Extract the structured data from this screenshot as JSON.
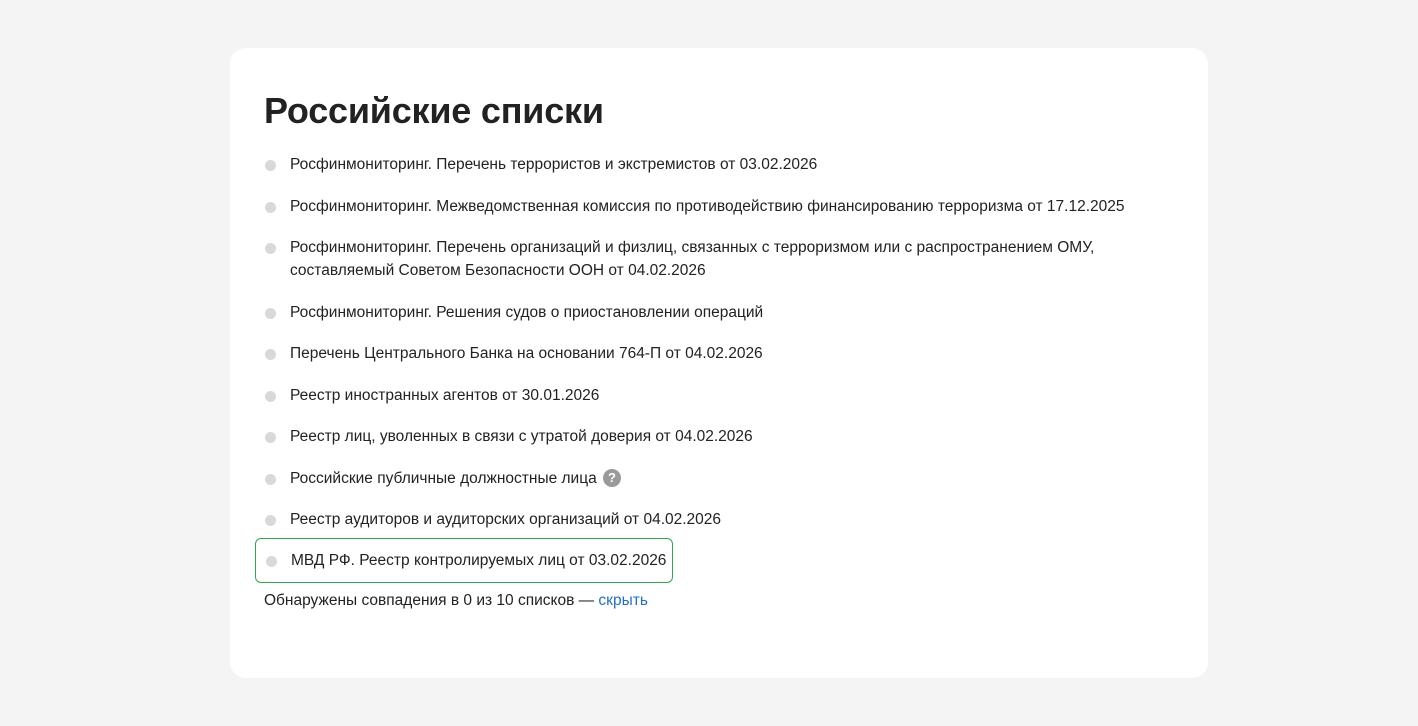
{
  "section": {
    "title": "Российские списки"
  },
  "lists": [
    {
      "label": "Росфинмониторинг. Перечень террористов и экстремистов от 03.02.2026"
    },
    {
      "label": "Росфинмониторинг. Межведомственная комиссия по противодействию финансированию терроризма от 17.12.2025"
    },
    {
      "label": "Росфинмониторинг. Перечень организаций и физлиц, связанных с терроризмом или с распространением ОМУ, составляемый Советом Безопасности ООН от 04.02.2026"
    },
    {
      "label": "Росфинмониторинг. Решения судов о приостановлении операций"
    },
    {
      "label": "Перечень Центрального Банка на основании 764-П от 04.02.2026"
    },
    {
      "label": "Реестр иностранных агентов от 30.01.2026"
    },
    {
      "label": "Реестр лиц, уволенных в связи с утратой доверия от 04.02.2026"
    },
    {
      "label": "Российские публичные должностные лица",
      "help_icon": "question-circle-icon",
      "help_glyph": "?"
    },
    {
      "label": "Реестр аудиторов и аудиторских организаций от 04.02.2026"
    },
    {
      "label": "МВД РФ. Реестр контролируемых лиц от 03.02.2026",
      "highlighted": true
    }
  ],
  "summary": {
    "text": "Обнаружены совпадения в 0 из 10 списков — ",
    "link_label": "скрыть"
  },
  "colors": {
    "background": "#f4f4f4",
    "card": "#ffffff",
    "bullet": "#d9d9d9",
    "highlight_border": "#2ea84a",
    "link": "#1f6fd1",
    "help_icon": "#9a9a9a"
  }
}
